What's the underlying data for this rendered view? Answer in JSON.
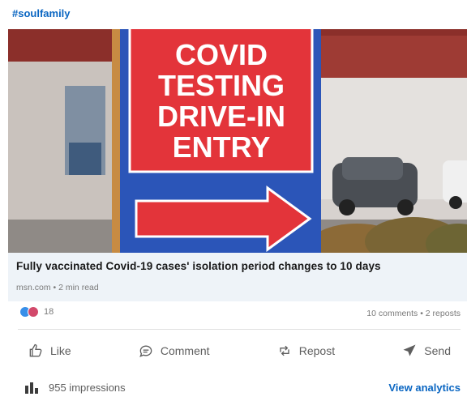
{
  "post": {
    "hashtag": "#soulfamily",
    "image_sign_lines": [
      "COVID",
      "TESTING",
      "DRIVE-IN",
      "ENTRY"
    ]
  },
  "article": {
    "title": "Fully vaccinated Covid-19 cases' isolation period changes to 10 days",
    "meta": "msn.com • 2 min read"
  },
  "social": {
    "reaction_count": "18",
    "reaction_icons": [
      "like-icon",
      "celebrate-icon"
    ],
    "counts": "10 comments • 2 reposts"
  },
  "actions": {
    "like": "Like",
    "comment": "Comment",
    "repost": "Repost",
    "send": "Send"
  },
  "footer": {
    "impressions": "955 impressions",
    "analytics": "View analytics"
  },
  "colors": {
    "accent": "#0a66c2",
    "sign_red": "#e3343a",
    "sign_blue": "#2b55b8"
  }
}
